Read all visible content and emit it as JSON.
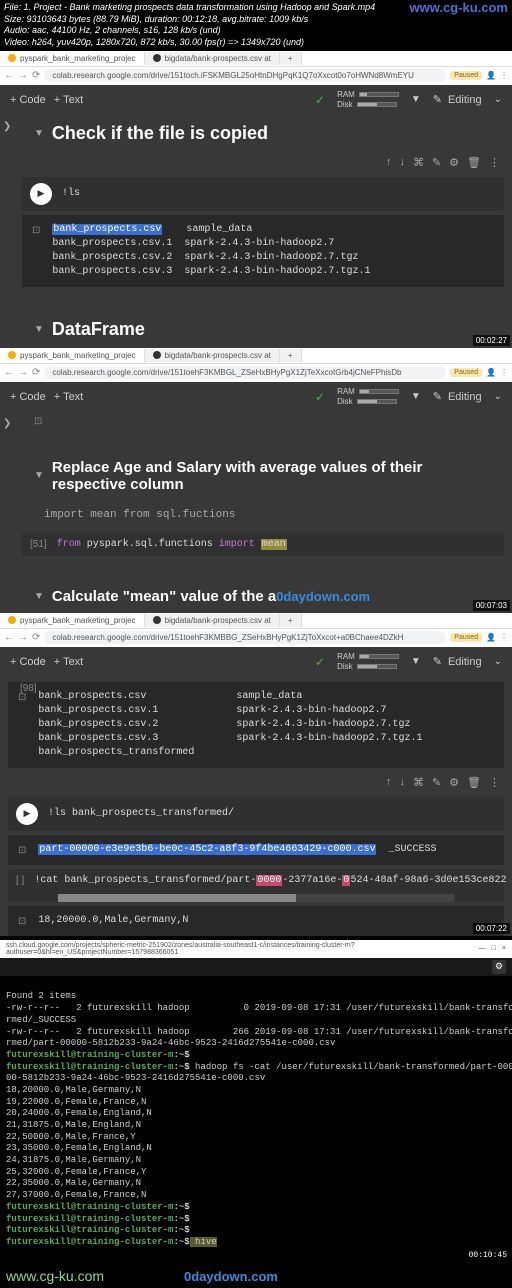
{
  "header": {
    "file": "File: 1. Project - Bank marketing prospects data transformation using Hadoop and Spark.mp4",
    "size": "Size: 93103643 bytes (88.79 MiB), duration: 00:12:18, avg.bitrate: 1009 kb/s",
    "audio": "Audio: aac, 44100 Hz, 2 channels, s16, 128 kb/s (und)",
    "video": "Video: h264, yuv420p, 1280x720, 872 kb/s, 30.00 fps(r) => 1349x720 (und)",
    "watermark": "www.cg-ku.com"
  },
  "tabs": {
    "t1": "pyspark_bank_marketing_projec",
    "t2": "bigdata/bank-prospects.csv at"
  },
  "urls": {
    "u1": "colab.research.google.com/drive/151toch.iFSKMBGL25oHtnDHgPqK1Q7oXxcot0o7oHWNd8WmEYU",
    "u2": "colab.research.google.com/drive/151toehF3KMBGL_ZSeHxBHyPgX1ZjTeXxcotGrb4jCNeFPhisDb",
    "u3": "colab.research.google.com/drive/151toehF3KMBBG_ZSeHxBHyPgK1ZjToXxcot+a0BChaee4DZkH"
  },
  "toolbar": {
    "code": "+ Code",
    "text": "+ Text",
    "ram": "RAM",
    "disk": "Disk",
    "editing": "Editing",
    "paused": "Paused"
  },
  "section1": {
    "heading": "Check if the file is copied",
    "code": "!ls",
    "output_hl": "bank_prospects.csv",
    "output": "    sample_data\nbank_prospects.csv.1  spark-2.4.3-bin-hadoop2.7\nbank_prospects.csv.2  spark-2.4.3-bin-hadoop2.7.tgz\nbank_prospects.csv.3  spark-2.4.3-bin-hadoop2.7.tgz.1",
    "heading2": "DataFrame",
    "time": "00:02:27"
  },
  "section2": {
    "heading": "Replace Age and Salary with average values of their respective column",
    "md": "import mean from sql.fuctions",
    "cellnum": "[51]",
    "code_from": "from ",
    "code_mod": "pyspark.sql.functions ",
    "code_import": "import ",
    "code_mean": "mean",
    "heading2_pre": "Calculate \"mean\" value of the a",
    "watermark": "0daydown.com",
    "time": "00:07:03"
  },
  "section3": {
    "cellnum": "[98]",
    "output1": "bank_prospects.csv               sample_data\nbank_prospects.csv.1             spark-2.4.3-bin-hadoop2.7\nbank_prospects.csv.2             spark-2.4.3-bin-hadoop2.7.tgz\nbank_prospects.csv.3             spark-2.4.3-bin-hadoop2.7.tgz.1\nbank_prospects_transformed",
    "code2": "!ls bank_prospects_transformed/",
    "output2_hl": "part-00000-e3e9e3b6-be0c-45c2-a8f3-9f4be4663429-c000.csv",
    "output2_rest": "  _SUCCESS",
    "cellnum3": "[ ]",
    "code3_pre": "!cat bank_prospects_transformed/part-",
    "code3_h1": "0000",
    "code3_m1": "-2377a16e-",
    "code3_h2": "0",
    "code3_m2": "524-48af-98a6-3d0e153ce822",
    "output3": "18,20000.0,Male,Germany,N",
    "time": "00:07:22"
  },
  "cloud": {
    "url": "ssh.cloud.google.com/projects/spheric-metric-251902/zones/australia-southeast1-c/instances/training-cluster-m?authuser=0&hl=en_US&projectNumber=157988366051"
  },
  "terminal": {
    "line1": "Found 2 items",
    "line2": "-rw-r--r--   2 futurexskill hadoop          0 2019-09-08 17:31 /user/futurexskill/bank-transfo",
    "line3": "rmed/_SUCCESS",
    "line4": "-rw-r--r--   2 futurexskill hadoop        266 2019-09-08 17:31 /user/futurexskill/bank-transfo",
    "line5": "rmed/part-00000-5812b233-9a24-46bc-9523-2416d275541e-c000.csv",
    "prompt": "futurexskill@training-cluster-m",
    "tilde": ":~$",
    "cmd_hadoop": " hadoop fs -cat /user/futurexskill/bank-transformed/part-000",
    "line7": "00-5812b233-9a24-46bc-9523-2416d275541e-c000.csv",
    "d1": "18,20000.0,Male,Germany,N",
    "d2": "19,22000.0,Female,France,N",
    "d3": "20,24000.0,Female,England,N",
    "d4": "21,31875.0,Male,England,N",
    "d5": "22,50000.0,Male,France,Y",
    "d6": "23,35000.0,Female,England,N",
    "d7": "24,31875.0,Male,Germany,N",
    "d8": "25,32000.0,Female,France,Y",
    "d9": "22,35000.0,Male,Germany,N",
    "d10": "27,37000.0,Female,France,N",
    "cmd_hive": " hive",
    "time": "00:10:45"
  },
  "footer": {
    "site": "www.cg-ku.com",
    "brand": "0daydown.com"
  }
}
